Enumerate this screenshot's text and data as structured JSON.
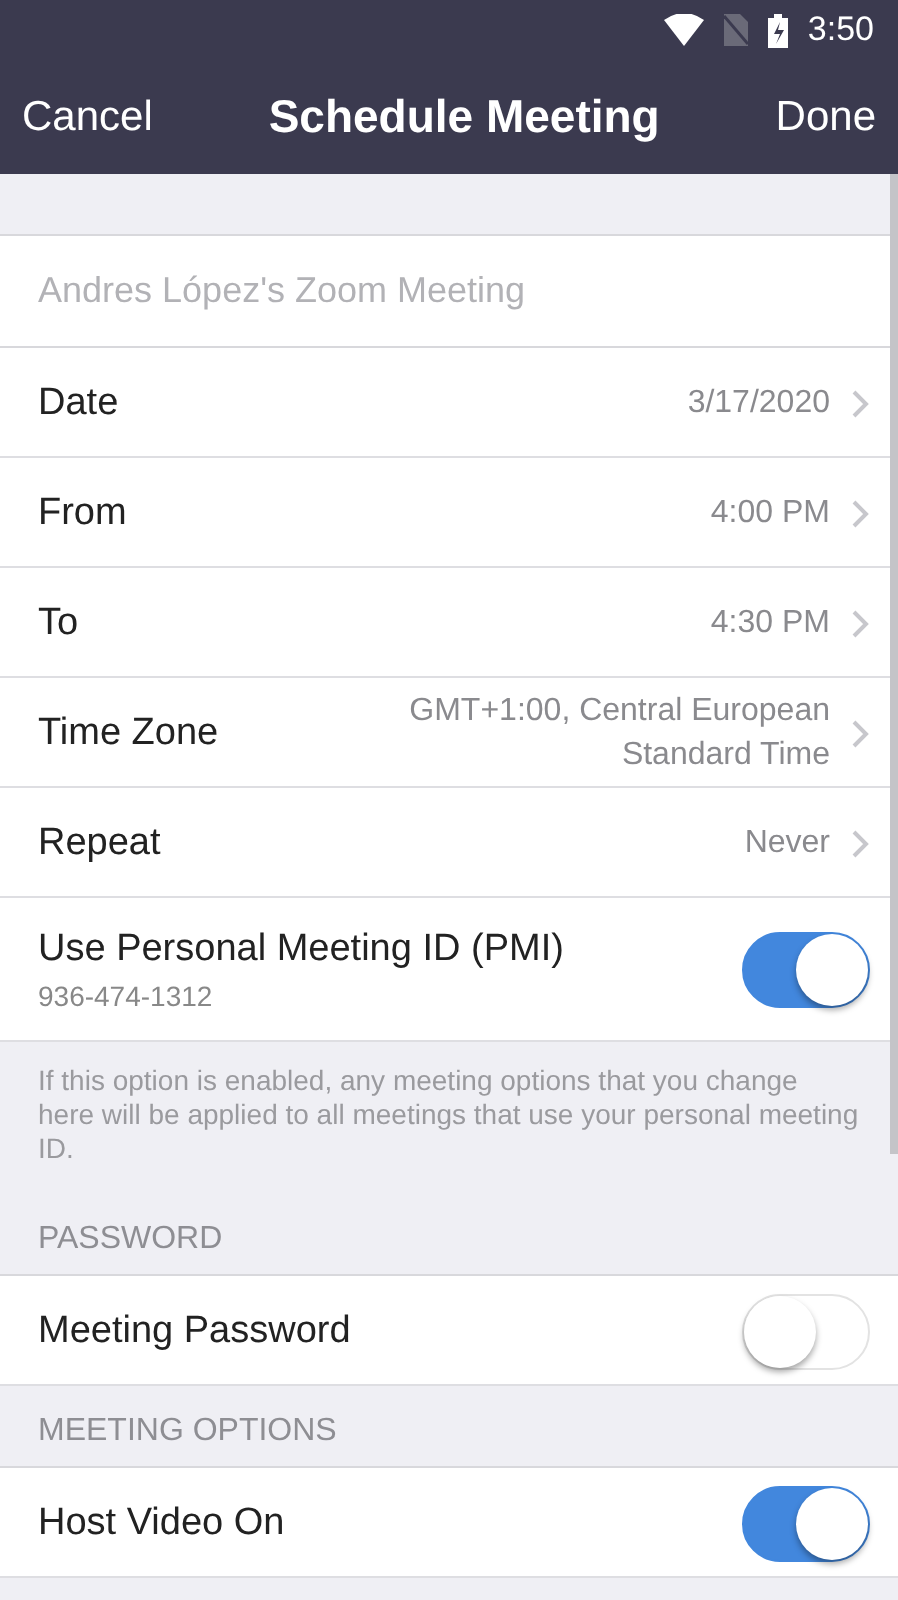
{
  "status_bar": {
    "time": "3:50"
  },
  "nav": {
    "cancel": "Cancel",
    "title": "Schedule Meeting",
    "done": "Done"
  },
  "rows": [
    {
      "kind": "spacer"
    },
    {
      "kind": "field",
      "placeholder": "Andres López's Zoom Meeting"
    },
    {
      "kind": "nav",
      "label": "Date",
      "value": "3/17/2020"
    },
    {
      "kind": "nav",
      "label": "From",
      "value": "4:00 PM"
    },
    {
      "kind": "nav",
      "label": "To",
      "value": "4:30 PM"
    },
    {
      "kind": "nav",
      "label": "Time Zone",
      "value": "GMT+1:00, Central European Standard Time"
    },
    {
      "kind": "nav",
      "label": "Repeat",
      "value": "Never"
    },
    {
      "kind": "toggle",
      "label": "Use Personal Meeting ID (PMI)",
      "sub": "936-474-1312",
      "on": true
    },
    {
      "kind": "note",
      "text": "If this option is enabled, any meeting options that you change here will be applied to all meetings that use your personal meeting ID."
    },
    {
      "kind": "header",
      "text": "PASSWORD"
    },
    {
      "kind": "toggle",
      "label": "Meeting Password",
      "on": false
    },
    {
      "kind": "header",
      "text": "MEETING OPTIONS"
    },
    {
      "kind": "toggle",
      "label": "Host Video On",
      "on": true
    }
  ]
}
